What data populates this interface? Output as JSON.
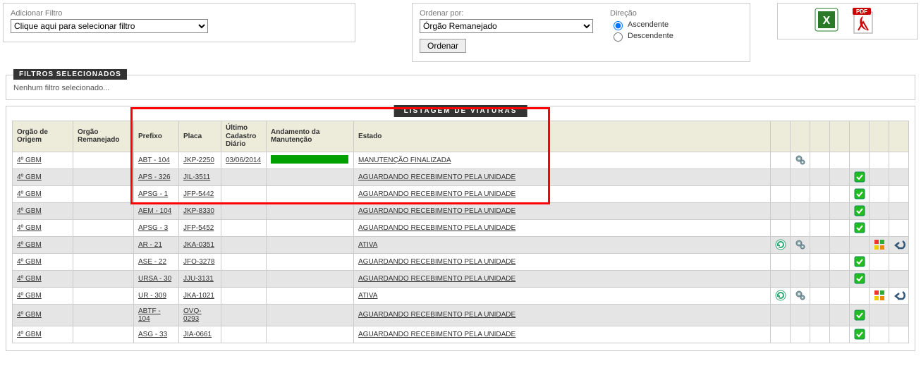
{
  "filter": {
    "label": "Adicionar Filtro",
    "select_text": "Clique aqui para selecionar filtro"
  },
  "sort": {
    "label": "Ordenar por:",
    "select_text": "Órgão Remanejado",
    "dir_label": "Direção",
    "asc_label": "Ascendente",
    "desc_label": "Descendente",
    "button": "Ordenar"
  },
  "filters_panel": {
    "legend": "FILTROS SELECIONADOS",
    "empty_text": "Nenhum filtro selecionado..."
  },
  "listing": {
    "title": "LISTAGEM DE VIATURAS",
    "headers": {
      "origem": "Orgão de Origem",
      "reman": "Orgão Remanejado",
      "prefixo": "Prefixo",
      "placa": "Placa",
      "ultimo": "Último Cadastro Diário",
      "andamento": "Andamento da Manutenção",
      "estado": "Estado"
    },
    "rows": [
      {
        "origem": "4º GBM",
        "reman": "",
        "prefixo": "ABT - 104",
        "placa": "JKP-2250",
        "ultimo": "03/06/2014",
        "progress": true,
        "estado": "MANUTENÇÃO FINALIZADA",
        "icons": {
          "gears": true
        }
      },
      {
        "origem": "4º GBM",
        "reman": "",
        "prefixo": "APS - 326",
        "placa": "JIL-3511",
        "ultimo": "",
        "progress": false,
        "estado": "AGUARDANDO RECEBIMENTO PELA UNIDADE",
        "icons": {
          "check": true
        }
      },
      {
        "origem": "4º GBM",
        "reman": "",
        "prefixo": "APSG - 1",
        "placa": "JFP-5442",
        "ultimo": "",
        "progress": false,
        "estado": "AGUARDANDO RECEBIMENTO PELA UNIDADE",
        "icons": {
          "check": true
        }
      },
      {
        "origem": "4º GBM",
        "reman": "",
        "prefixo": "AEM - 104",
        "placa": "JKP-8330",
        "ultimo": "",
        "progress": false,
        "estado": "AGUARDANDO RECEBIMENTO PELA UNIDADE",
        "icons": {
          "check": true
        }
      },
      {
        "origem": "4º GBM",
        "reman": "",
        "prefixo": "APSG - 3",
        "placa": "JFP-5452",
        "ultimo": "",
        "progress": false,
        "estado": "AGUARDANDO RECEBIMENTO PELA UNIDADE",
        "icons": {
          "check": true
        }
      },
      {
        "origem": "4º GBM",
        "reman": "",
        "prefixo": "AR - 21",
        "placa": "JKA-0351",
        "ultimo": "",
        "progress": false,
        "estado": "ATIVA",
        "icons": {
          "refresh": true,
          "gears": true,
          "color": true,
          "back": true
        }
      },
      {
        "origem": "4º GBM",
        "reman": "",
        "prefixo": "ASE - 22",
        "placa": "JFO-3278",
        "ultimo": "",
        "progress": false,
        "estado": "AGUARDANDO RECEBIMENTO PELA UNIDADE",
        "icons": {
          "check": true
        }
      },
      {
        "origem": "4º GBM",
        "reman": "",
        "prefixo": "URSA - 30",
        "placa": "JJU-3131",
        "ultimo": "",
        "progress": false,
        "estado": "AGUARDANDO RECEBIMENTO PELA UNIDADE",
        "icons": {
          "check": true
        }
      },
      {
        "origem": "4º GBM",
        "reman": "",
        "prefixo": "UR - 309",
        "placa": "JKA-1021",
        "ultimo": "",
        "progress": false,
        "estado": "ATIVA",
        "icons": {
          "refresh": true,
          "gears": true,
          "color": true,
          "back": true
        }
      },
      {
        "origem": "4º GBM",
        "reman": "",
        "prefixo": "ABTF - 104",
        "placa": "OVQ-0293",
        "ultimo": "",
        "progress": false,
        "estado": "AGUARDANDO RECEBIMENTO PELA UNIDADE",
        "icons": {
          "check": true
        }
      },
      {
        "origem": "4º GBM",
        "reman": "",
        "prefixo": "ASG - 33",
        "placa": "JIA-0661",
        "ultimo": "",
        "progress": false,
        "estado": "AGUARDANDO RECEBIMENTO PELA UNIDADE",
        "icons": {
          "check": true
        }
      }
    ]
  }
}
